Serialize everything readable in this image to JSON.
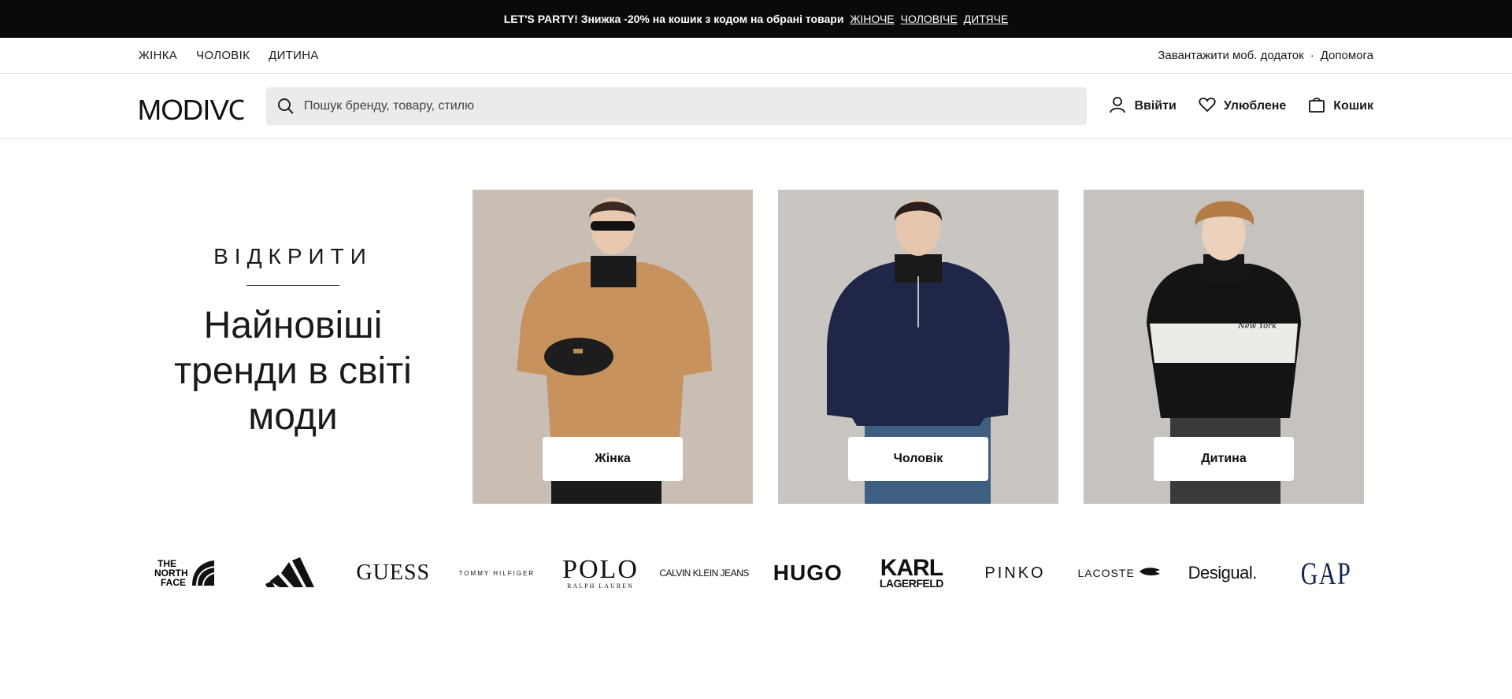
{
  "promo": {
    "text": "LET'S PARTY! Знижка -20% на кошик з кодом на обрані товари",
    "links": [
      "ЖІНОЧЕ",
      "ЧОЛОВІЧЕ",
      "ДИТЯЧЕ"
    ]
  },
  "topnav": {
    "left": [
      "ЖІНКА",
      "ЧОЛОВІК",
      "ДИТИНА"
    ],
    "app_download": "Завантажити моб. додаток",
    "separator": "·",
    "help": "Допомога"
  },
  "header": {
    "logo": "MODIVO",
    "search_placeholder": "Пошук бренду, товару, стилю",
    "login": "Ввійти",
    "favorites": "Улюблене",
    "cart": "Кошик"
  },
  "hero": {
    "kicker": "ВІДКРИТИ",
    "title_lines": [
      "Найновіші",
      "тренди в світі",
      "моди"
    ]
  },
  "cards": [
    {
      "label": "Жінка",
      "icon": "woman-photo"
    },
    {
      "label": "Чоловік",
      "icon": "man-photo"
    },
    {
      "label": "Дитина",
      "icon": "child-photo"
    }
  ],
  "brands": {
    "north_face": [
      "THE",
      "NORTH",
      "FACE"
    ],
    "adidas": "adidas-logo",
    "guess": "GUESS",
    "tommy": "TOMMY HILFIGER",
    "polo": "POLO",
    "polo_sub": "RALPH LAUREN",
    "calvin": "CALVIN KLEIN JEANS",
    "hugo": "HUGO",
    "karl": [
      "KARL",
      "LAGERFELD"
    ],
    "pinko": "PINKO",
    "lacoste": "LACOSTE",
    "desigual": "Desigual.",
    "gap": "GAP"
  },
  "colors": {
    "promo_bg": "#0a0a0a",
    "search_bg": "#ebeaec",
    "card_bg": "#c9c1b8"
  }
}
